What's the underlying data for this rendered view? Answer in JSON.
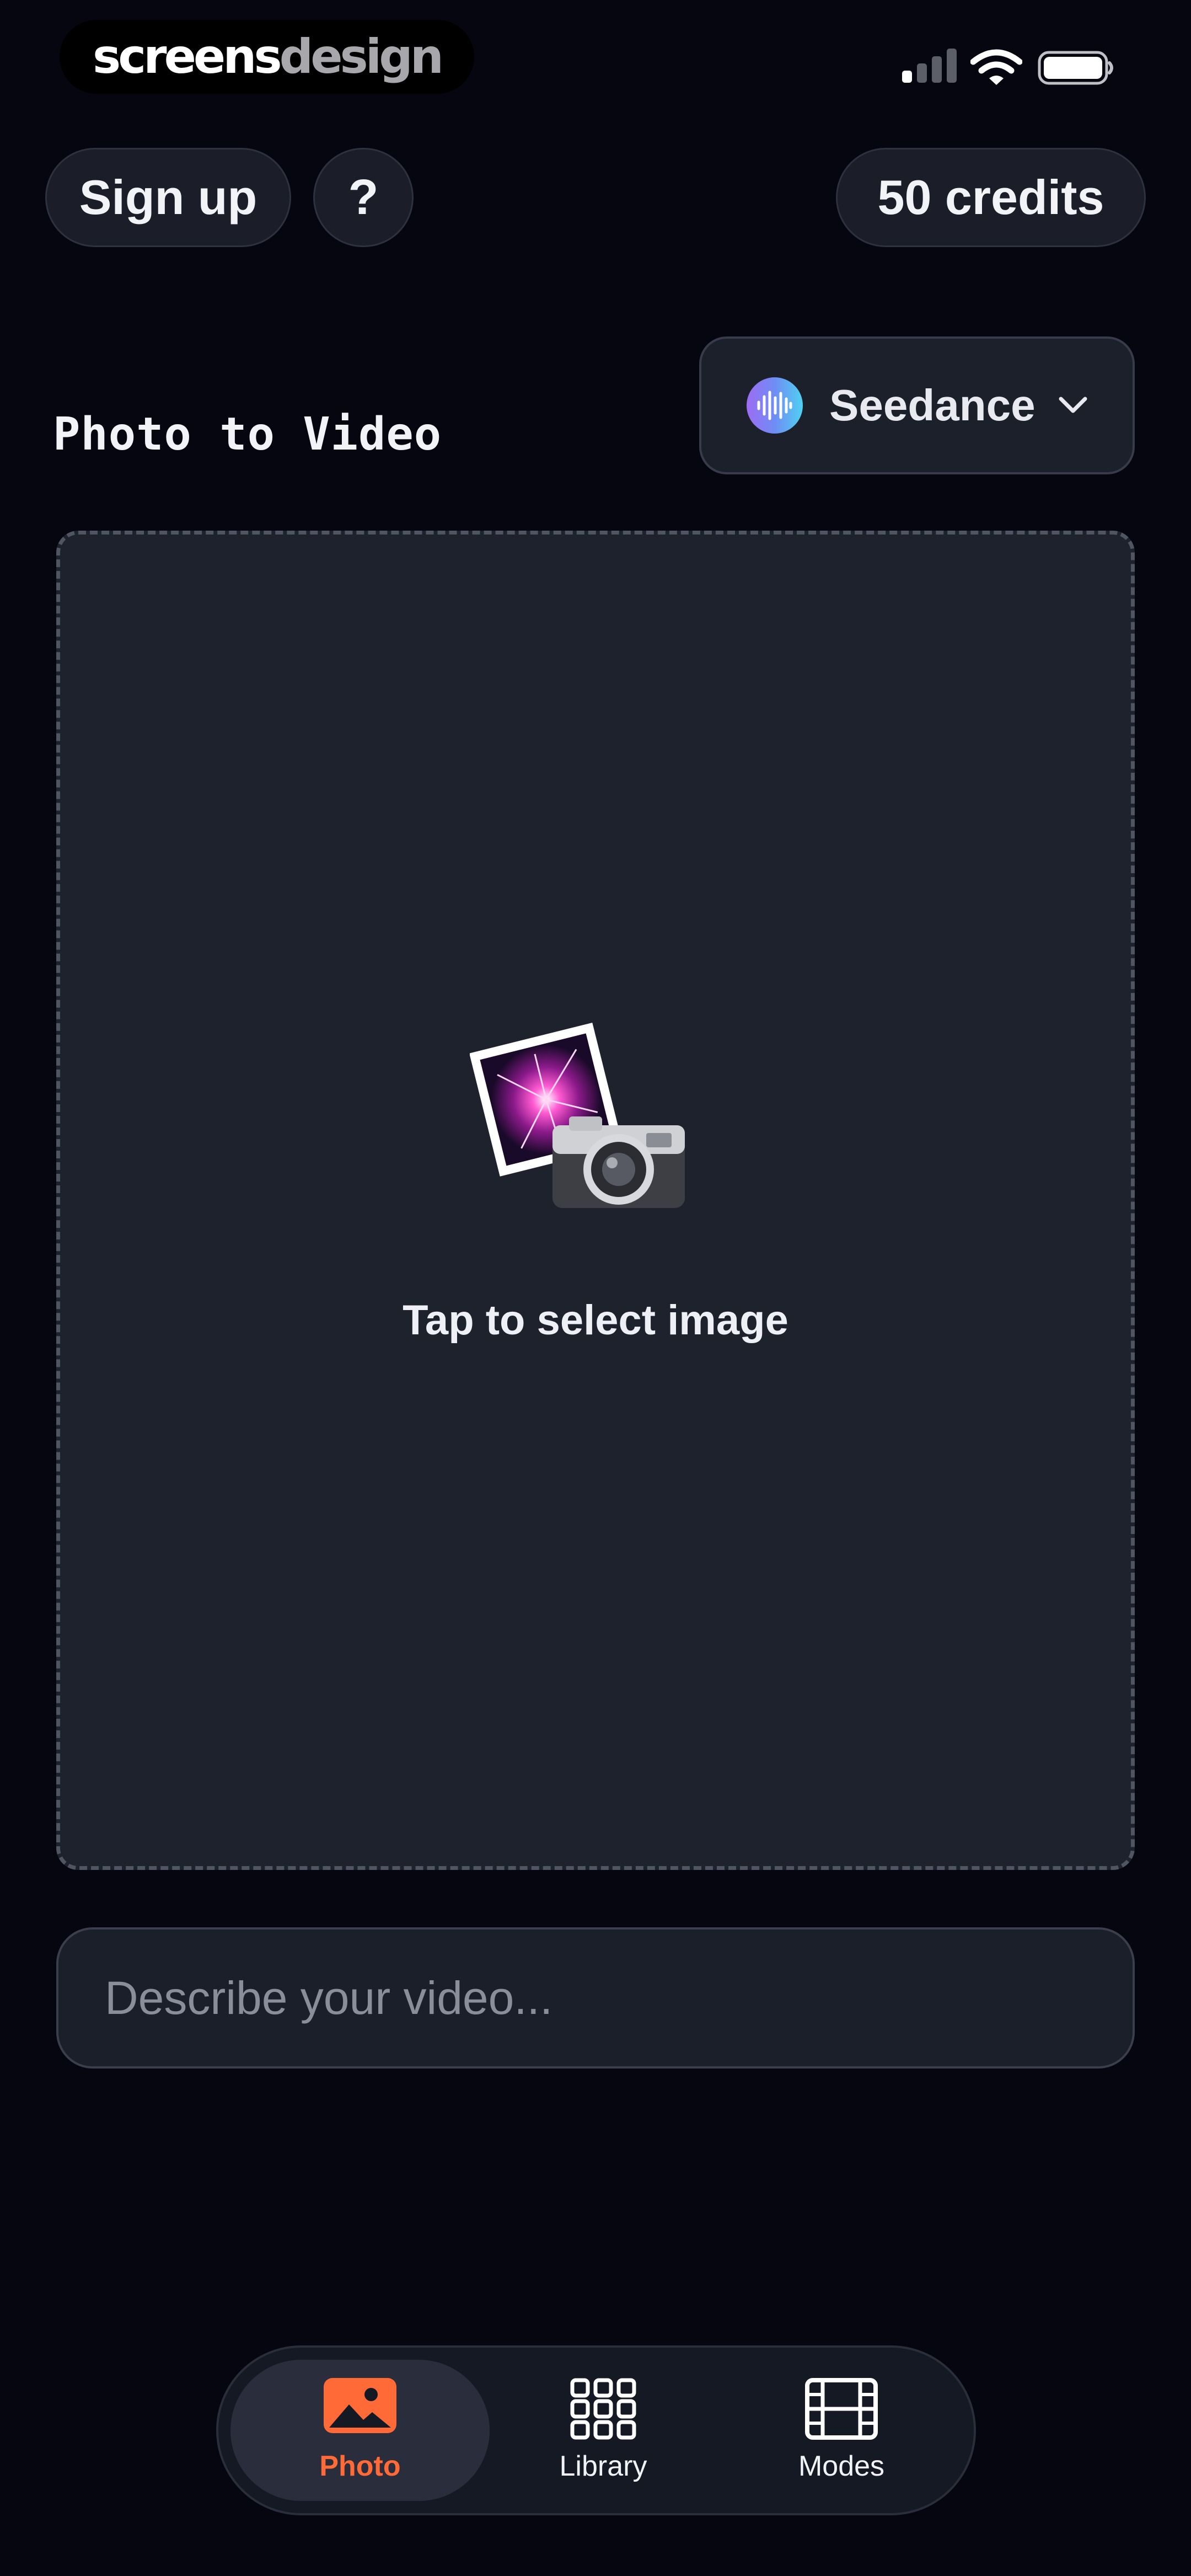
{
  "status_bar": {
    "brand_part1": "screens",
    "brand_part2": "design",
    "icons": [
      "signal-icon",
      "wifi-icon",
      "battery-icon"
    ]
  },
  "header": {
    "signup_label": "Sign up",
    "help_label": "?",
    "credits_label": "50 credits"
  },
  "main": {
    "section_title": "Photo to Video",
    "model": {
      "label": "Seedance",
      "icon": "waveform-icon"
    },
    "dropzone": {
      "text": "Tap to select image",
      "icon": "camera-photo-icon"
    },
    "prompt": {
      "placeholder": "Describe your video...",
      "value": ""
    }
  },
  "tabs": [
    {
      "label": "Photo",
      "icon": "image-icon",
      "active": true
    },
    {
      "label": "Library",
      "icon": "grid-icon",
      "active": false
    },
    {
      "label": "Modes",
      "icon": "film-icon",
      "active": false
    }
  ],
  "colors": {
    "background": "#05060f",
    "accent": "#ff6a36",
    "surface": "#1e222d"
  }
}
